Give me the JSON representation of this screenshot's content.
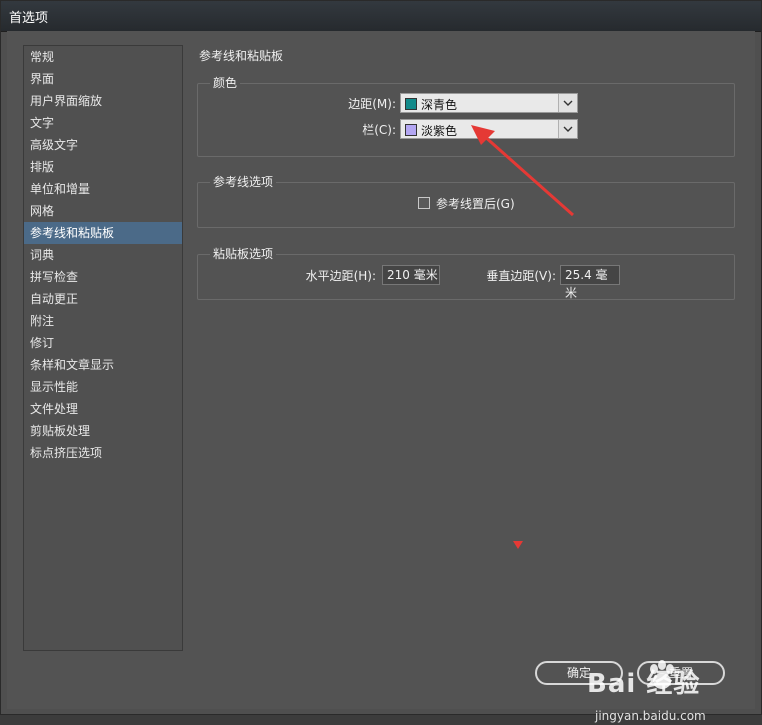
{
  "window": {
    "title": "首选项"
  },
  "sidebar": {
    "items": [
      {
        "label": "常规"
      },
      {
        "label": "界面"
      },
      {
        "label": "用户界面缩放"
      },
      {
        "label": "文字"
      },
      {
        "label": "高级文字"
      },
      {
        "label": "排版"
      },
      {
        "label": "单位和增量"
      },
      {
        "label": "网格"
      },
      {
        "label": "参考线和粘贴板",
        "selected": true
      },
      {
        "label": "词典"
      },
      {
        "label": "拼写检查"
      },
      {
        "label": "自动更正"
      },
      {
        "label": "附注"
      },
      {
        "label": "修订"
      },
      {
        "label": "条样和文章显示"
      },
      {
        "label": "显示性能"
      },
      {
        "label": "文件处理"
      },
      {
        "label": "剪贴板处理"
      },
      {
        "label": "标点挤压选项"
      }
    ]
  },
  "main": {
    "title": "参考线和粘贴板",
    "color_group": {
      "label": "颜色",
      "margin_label": "边距(M):",
      "margin_value": "深青色",
      "margin_color": "#138a8a",
      "column_label": "栏(C):",
      "column_value": "淡紫色",
      "column_color": "#b3a6f2"
    },
    "guide_group": {
      "label": "参考线选项",
      "guides_behind_label": "参考线置后(G)",
      "guides_behind_checked": false
    },
    "pasteboard_group": {
      "label": "粘贴板选项",
      "horizontal_label": "水平边距(H):",
      "horizontal_value": "210 毫米",
      "vertical_label": "垂直边距(V):",
      "vertical_value": "25.4 毫米"
    }
  },
  "buttons": {
    "ok_label": "确定",
    "reset_label": "重置"
  },
  "watermark": {
    "brand": "Bai 经验",
    "url": "jingyan.baidu.com"
  },
  "annotation_color": "#e53935"
}
